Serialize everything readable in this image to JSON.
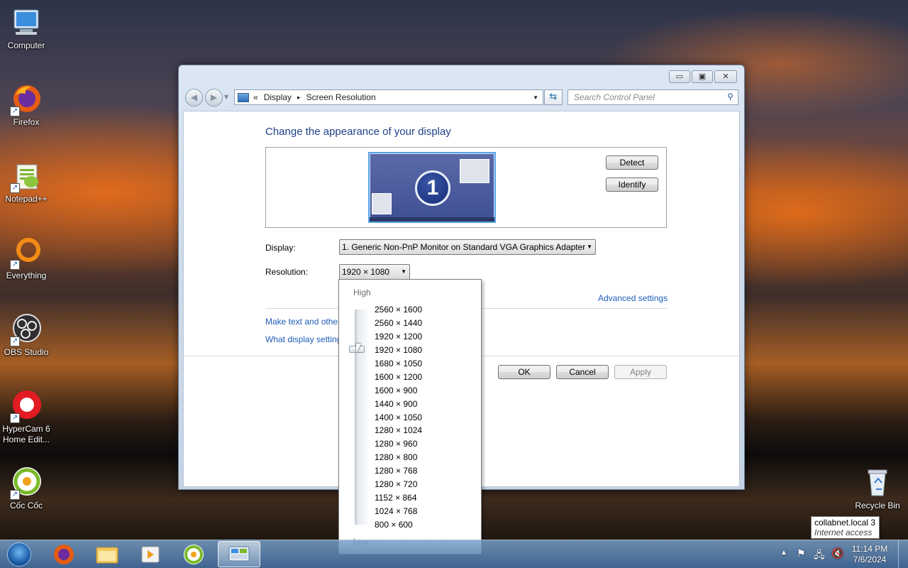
{
  "desktop": {
    "icons": [
      {
        "label": "Computer",
        "icon": "computer-icon"
      },
      {
        "label": "Firefox",
        "icon": "firefox-icon"
      },
      {
        "label": "Notepad++",
        "icon": "notepadpp-icon"
      },
      {
        "label": "Everything",
        "icon": "everything-icon"
      },
      {
        "label": "OBS Studio",
        "icon": "obs-icon"
      },
      {
        "label": "HyperCam 6 Home Edit...",
        "icon": "hypercam-icon"
      },
      {
        "label": "Cốc Cốc",
        "icon": "coccoc-icon"
      }
    ],
    "recycle_bin": {
      "label": "Recycle Bin",
      "icon": "recycle-bin-icon"
    }
  },
  "window": {
    "caption_buttons": {
      "minimize": "▭",
      "maximize": "▣",
      "close": "✕"
    },
    "address": {
      "prefix": "«",
      "crumb1": "Display",
      "sep": "▸",
      "crumb2": "Screen Resolution"
    },
    "search_placeholder": "Search Control Panel",
    "heading": "Change the appearance of your display",
    "monitor_number": "1",
    "detect_label": "Detect",
    "identify_label": "Identify",
    "display_label": "Display:",
    "display_value": "1. Generic Non-PnP Monitor on Standard VGA Graphics Adapter",
    "resolution_label": "Resolution:",
    "resolution_value": "1920 × 1080",
    "advanced_settings": "Advanced settings",
    "link_text_size": "Make text and other",
    "link_display_settings": "What display setting",
    "ok_label": "OK",
    "cancel_label": "Cancel",
    "apply_label": "Apply"
  },
  "resolution_dropdown": {
    "high_label": "High",
    "low_label": "Low",
    "options": [
      "2560 × 1600",
      "2560 × 1440",
      "1920 × 1200",
      "1920 × 1080",
      "1680 × 1050",
      "1600 × 1200",
      "1600 × 900",
      "1440 × 900",
      "1400 × 1050",
      "1280 × 1024",
      "1280 × 960",
      "1280 × 800",
      "1280 × 768",
      "1280 × 720",
      "1152 × 864",
      "1024 × 768",
      "800 × 600"
    ],
    "selected_index": 3
  },
  "tooltip": {
    "line1": "collabnet.local  3",
    "line2": "Internet access"
  },
  "taskbar": {
    "apps": [
      "firefox-icon",
      "file-explorer-icon",
      "media-player-icon",
      "coccoc-icon",
      "control-panel-icon"
    ],
    "time": "11:14 PM",
    "date": "7/6/2024"
  },
  "colors": {
    "link": "#1e5bb8",
    "heading": "#1e3f8a",
    "accent": "#5ba4e6"
  }
}
